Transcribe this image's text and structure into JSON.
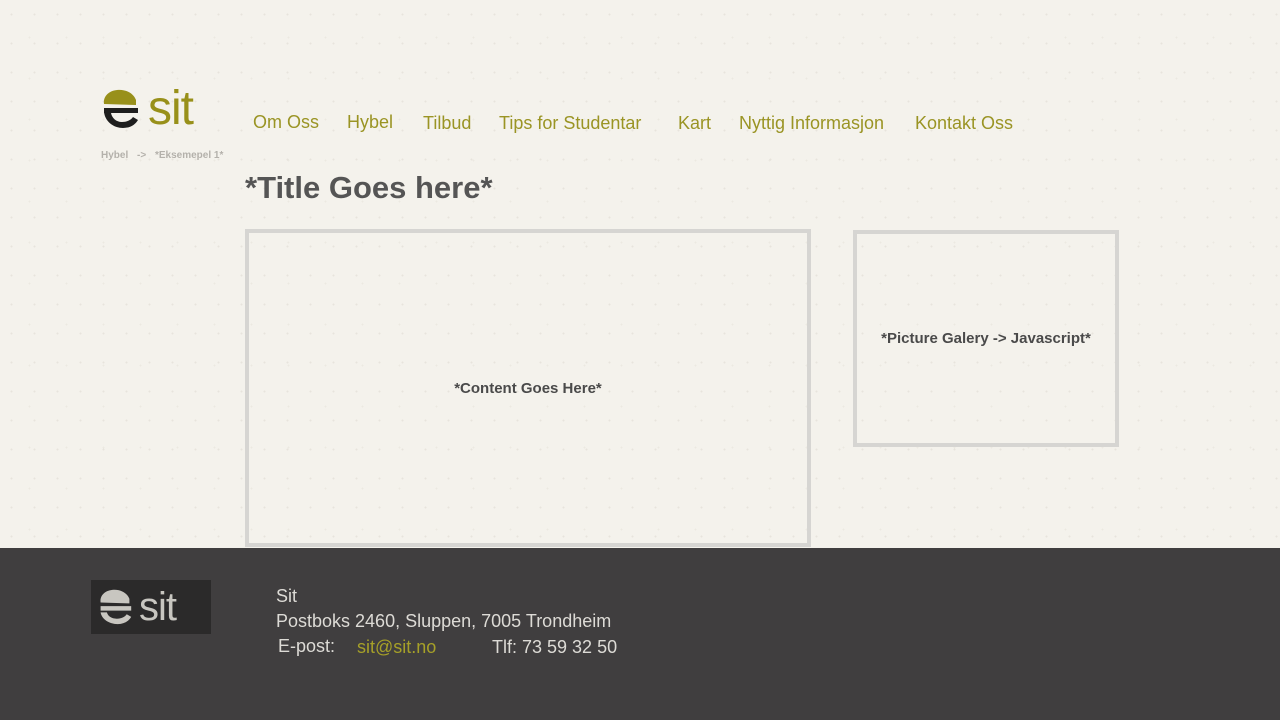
{
  "brand": {
    "name": "sit",
    "color": "#98901a"
  },
  "nav": {
    "items": [
      {
        "label": "Om Oss"
      },
      {
        "label": "Hybel"
      },
      {
        "label": "Tilbud"
      },
      {
        "label": "Tips for Studentar"
      },
      {
        "label": "Kart"
      },
      {
        "label": "Nyttig Informasjon"
      },
      {
        "label": "Kontakt Oss"
      }
    ]
  },
  "breadcrumb": {
    "parent": "Hybel",
    "separator": "->",
    "current": "*Eksemepel 1*"
  },
  "main": {
    "title": "*Title Goes here*",
    "content_placeholder": "*Content Goes Here*",
    "gallery_placeholder": "*Picture Galery -> Javascript*"
  },
  "footer": {
    "logo_text": "sit",
    "company": "Sit",
    "address": "Postboks 2460, Sluppen, 7005 Trondheim",
    "email_label": "E-post:",
    "email": "sit@sit.no",
    "phone": "Tlf: 73 59 32 50"
  }
}
